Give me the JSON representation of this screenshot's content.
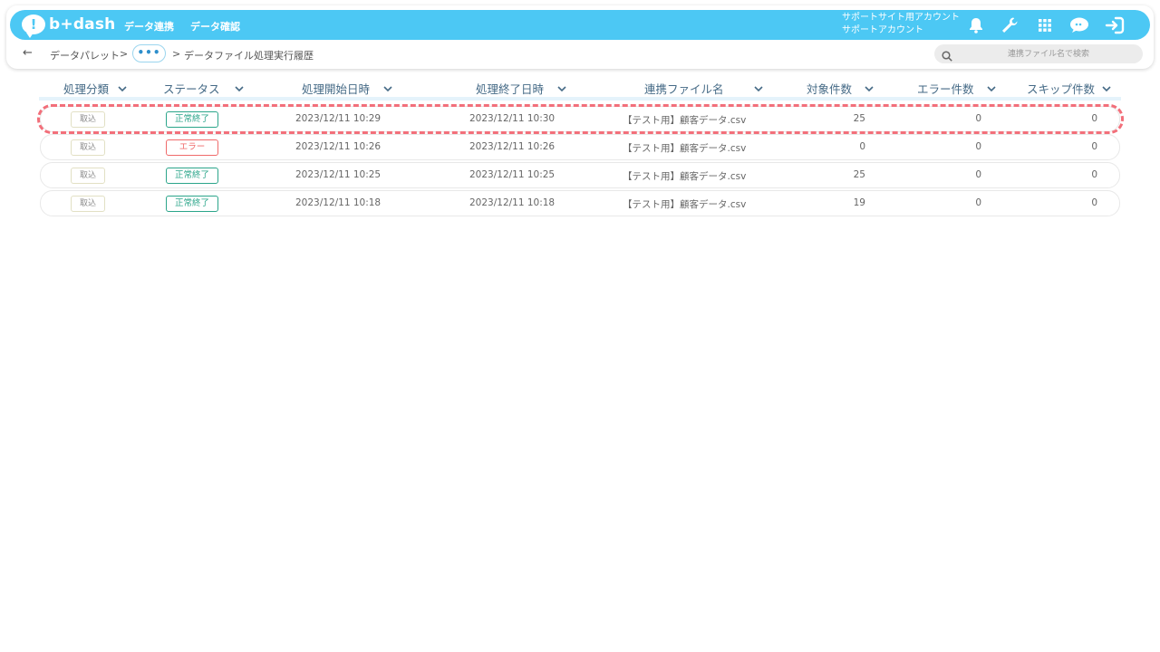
{
  "app": {
    "logo_mark": "!",
    "logo_text": "b+dash",
    "nav": [
      "データ連携",
      "データ確認"
    ],
    "account_line1": "サポートサイト用アカウント",
    "account_line2": "サポートアカウント",
    "icons": [
      "bell-icon",
      "wrench-icon",
      "grid-icon",
      "chat-icon",
      "logout-icon"
    ],
    "accent_color": "#4cc8f4"
  },
  "breadcrumb": {
    "back": "←",
    "items": [
      "データパレット",
      "データファイル処理実行履歴"
    ],
    "separator": ">",
    "more": "•••"
  },
  "search": {
    "placeholder": "連携ファイル名で検索"
  },
  "table": {
    "headers": [
      "処理分類",
      "ステータス",
      "処理開始日時",
      "処理終了日時",
      "連携ファイル名",
      "対象件数",
      "エラー件数",
      "スキップ件数"
    ],
    "rows": [
      {
        "kind": "取込",
        "status": "正常終了",
        "status_type": "ok",
        "start": "2023/12/11 10:29",
        "end": "2023/12/11 10:30",
        "file": "【テスト用】顧客データ.csv",
        "target": "25",
        "errors": "0",
        "skips": "0"
      },
      {
        "kind": "取込",
        "status": "エラー",
        "status_type": "error",
        "start": "2023/12/11 10:26",
        "end": "2023/12/11 10:26",
        "file": "【テスト用】顧客データ.csv",
        "target": "0",
        "errors": "0",
        "skips": "0"
      },
      {
        "kind": "取込",
        "status": "正常終了",
        "status_type": "ok",
        "start": "2023/12/11 10:25",
        "end": "2023/12/11 10:25",
        "file": "【テスト用】顧客データ.csv",
        "target": "25",
        "errors": "0",
        "skips": "0"
      },
      {
        "kind": "取込",
        "status": "正常終了",
        "status_type": "ok",
        "start": "2023/12/11 10:18",
        "end": "2023/12/11 10:18",
        "file": "【テスト用】顧客データ.csv",
        "target": "19",
        "errors": "0",
        "skips": "0"
      }
    ]
  },
  "highlight_color": "#f26f7a"
}
